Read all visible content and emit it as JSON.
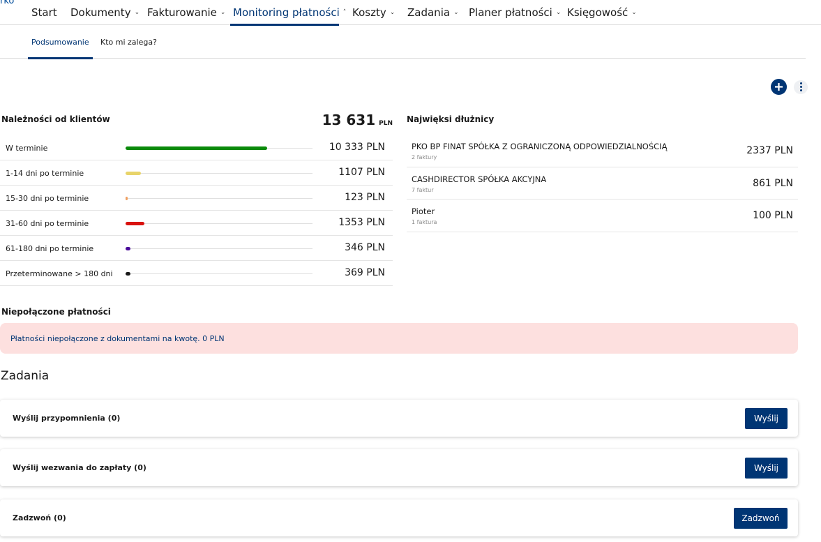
{
  "nav": {
    "brand_fragment": "rko",
    "items": [
      {
        "label": "Start",
        "has_chevron": false
      },
      {
        "label": "Dokumenty",
        "has_chevron": true
      },
      {
        "label": "Fakturowanie",
        "has_chevron": true
      },
      {
        "label": "Monitoring płatności",
        "has_chevron": true,
        "active": true,
        "chevron": "˄"
      },
      {
        "label": "Koszty",
        "has_chevron": true
      },
      {
        "label": "Zadania",
        "has_chevron": true
      },
      {
        "label": "Planer płatności",
        "has_chevron": true
      },
      {
        "label": "Księgowość",
        "has_chevron": true
      }
    ],
    "chevron_down": "⌄"
  },
  "subnav": {
    "tabs": [
      {
        "label": "Podsumowanie",
        "active": true
      },
      {
        "label": "Kto mi zalega?",
        "active": false
      }
    ]
  },
  "actions": {
    "add_icon": "plus-circle-icon",
    "menu_icon": "more-vertical-icon"
  },
  "receivables": {
    "title": "Należności od klientów",
    "total": "13 631",
    "currency": "PLN",
    "rows": [
      {
        "label": "W terminie",
        "amount": "10 333 PLN",
        "value": 10333,
        "color": "#0a8a0a"
      },
      {
        "label": "1-14 dni po terminie",
        "amount": "1107 PLN",
        "value": 1107,
        "color": "#e8d46a"
      },
      {
        "label": "15-30 dni po terminie",
        "amount": "123 PLN",
        "value": 123,
        "color": "#f0a060"
      },
      {
        "label": "31-60 dni po terminie",
        "amount": "1353 PLN",
        "value": 1353,
        "color": "#d9120f"
      },
      {
        "label": "61-180 dni po terminie",
        "amount": "346 PLN",
        "value": 346,
        "color": "#4a0a9a"
      },
      {
        "label": "Przeterminowane > 180 dni",
        "amount": "369 PLN",
        "value": 369,
        "color": "#1a1a1a"
      }
    ]
  },
  "debtors": {
    "title": "Najwięksi dłużnicy",
    "rows": [
      {
        "name": "PKO BP FINAT SPÓŁKA Z OGRANICZONĄ ODPOWIEDZIALNOŚCIĄ",
        "count": "2 faktury",
        "amount": "2337 PLN"
      },
      {
        "name": "CASHDIRECTOR SPÓŁKA AKCYJNA",
        "count": "7 faktur",
        "amount": "861 PLN"
      },
      {
        "name": "Pioter",
        "count": "1 faktura",
        "amount": "100 PLN"
      }
    ]
  },
  "unmatched": {
    "title": "Niepołączone płatności",
    "message": "Płatności niepołączone z dokumentami na kwotę. 0 PLN"
  },
  "tasks": {
    "title": "Zadania",
    "items": [
      {
        "label": "Wyślij przypomnienia (0)",
        "button": "Wyślij"
      },
      {
        "label": "Wyślij wezwania do zapłaty (0)",
        "button": "Wyślij"
      },
      {
        "label": "Zadzwoń (0)",
        "button": "Zadzwoń"
      }
    ]
  }
}
